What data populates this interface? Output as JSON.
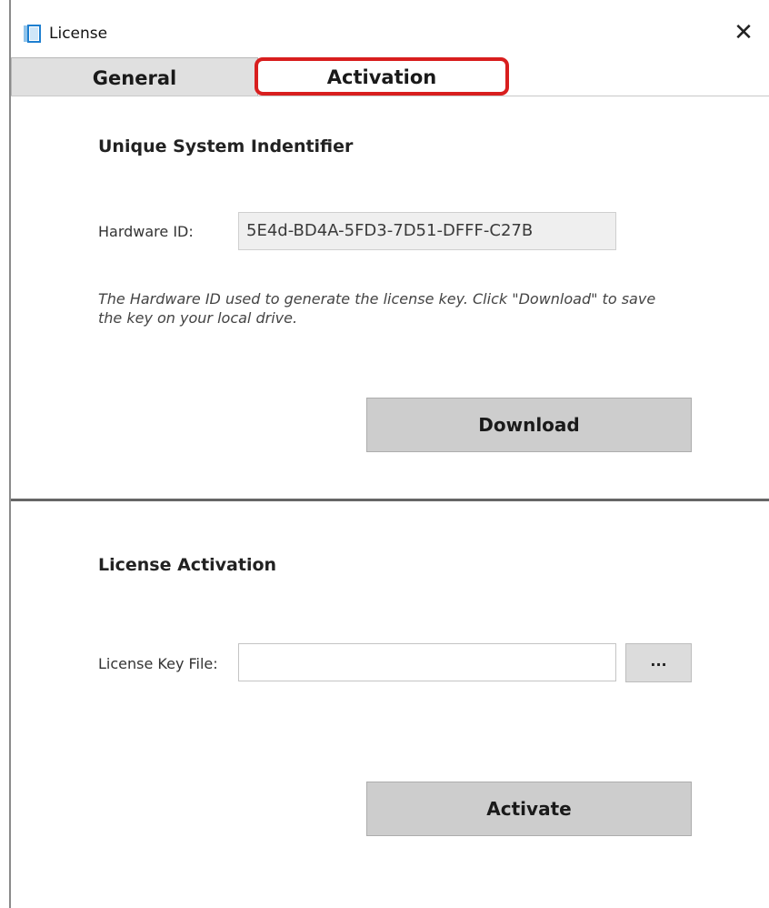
{
  "window": {
    "title": "License",
    "close_glyph": "✕",
    "icon": "license-app-icon"
  },
  "tabs": [
    {
      "label": "General",
      "active": false
    },
    {
      "label": "Activation",
      "active": true,
      "highlight_color": "#d81e1e"
    }
  ],
  "identifier_section": {
    "title": "Unique System Indentifier",
    "hardware_label": "Hardware ID:",
    "hardware_value": "5E4d-BD4A-5FD3-7D51-DFFF-C27B",
    "note": "The Hardware ID used to generate the license key.  Click \"Download\" to save the key on your local drive.",
    "download_label": "Download"
  },
  "activation_section": {
    "title": "License Activation",
    "key_file_label": "License Key File:",
    "key_file_value": "",
    "browse_label": "...",
    "activate_label": "Activate"
  }
}
